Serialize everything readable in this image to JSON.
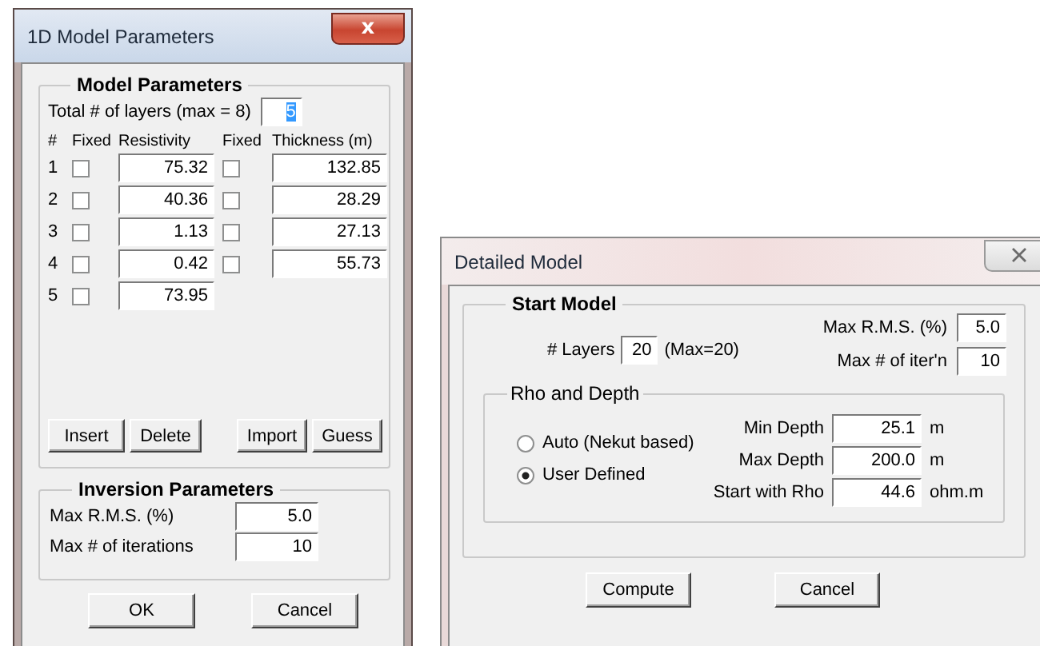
{
  "model_parameters_window": {
    "title": "1D Model Parameters",
    "close": "x",
    "model_parameters": {
      "title": "Model Parameters",
      "total_label": "Total # of  layers (max = 8)",
      "total_value": "5",
      "total_selected": true,
      "headers": [
        "#",
        "Fixed",
        "Resistivity",
        "Fixed",
        "Thickness (m)"
      ],
      "layers": [
        {
          "number": "1",
          "fixed_resistivity": false,
          "resistivity": "75.32",
          "fixed_thickness": false,
          "thickness": "132.85"
        },
        {
          "number": "2",
          "fixed_resistivity": false,
          "resistivity": "40.36",
          "fixed_thickness": false,
          "thickness": "28.29"
        },
        {
          "number": "3",
          "fixed_resistivity": false,
          "resistivity": "1.13",
          "fixed_thickness": false,
          "thickness": "27.13"
        },
        {
          "number": "4",
          "fixed_resistivity": false,
          "resistivity": "0.42",
          "fixed_thickness": false,
          "thickness": "55.73"
        },
        {
          "number": "5",
          "fixed_resistivity": false,
          "resistivity": "73.95"
        }
      ],
      "buttons": [
        "Insert",
        "Delete",
        "Import",
        "Guess"
      ]
    },
    "inversion_parameters": {
      "title": "Inversion Parameters",
      "fields": [
        {
          "label": "Max R.M.S. (%)",
          "value": "5.0"
        },
        {
          "label": "Max # of iterations",
          "value": "10"
        }
      ]
    },
    "buttons": [
      "OK",
      "Cancel"
    ]
  },
  "detailed_model_window": {
    "title": "Detailed Model",
    "start_model": {
      "title": "Start Model",
      "layers_label": "# Layers",
      "layers_value": "20",
      "layers_max": "(Max=20)",
      "fields": [
        {
          "label": "Max R.M.S. (%)",
          "value": "5.0"
        },
        {
          "label": "Max # of iter'n",
          "value": "10"
        }
      ],
      "rho_and_depth": {
        "title": "Rho and  Depth",
        "options": [
          {
            "label": "Auto (Nekut based)",
            "selected": false
          },
          {
            "label": "User Defined",
            "selected": true
          }
        ],
        "fields": [
          {
            "label": "Min Depth",
            "value": "25.1",
            "unit": "m"
          },
          {
            "label": "Max Depth",
            "value": "200.0",
            "unit": "m"
          },
          {
            "label": "Start with Rho",
            "value": "44.6",
            "unit": "ohm.m"
          }
        ]
      }
    },
    "buttons": [
      "Compute",
      "Cancel"
    ]
  }
}
